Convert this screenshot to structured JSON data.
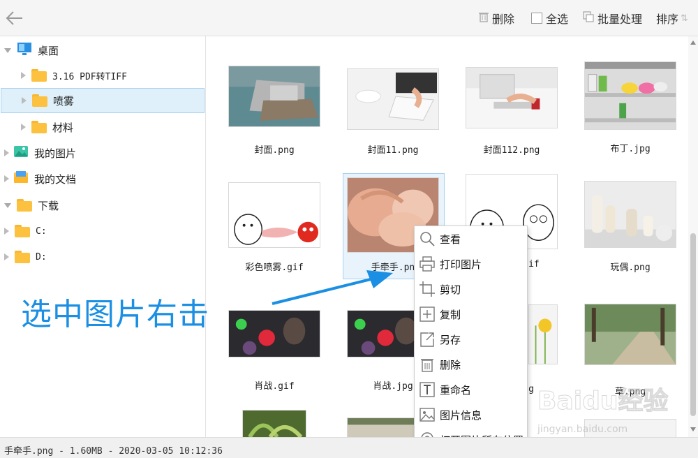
{
  "toolbar": {
    "delete_label": "删除",
    "select_all_label": "全选",
    "batch_label": "批量处理",
    "sort_label": "排序"
  },
  "sidebar": {
    "items": [
      {
        "label": "桌面",
        "icon": "desktop-icon",
        "expanded": true
      },
      {
        "label": "3.16 PDF转TIFF",
        "icon": "folder-icon",
        "expanded": false
      },
      {
        "label": "喷雾",
        "icon": "folder-icon",
        "expanded": false,
        "selected": true
      },
      {
        "label": "材料",
        "icon": "folder-icon",
        "expanded": false
      },
      {
        "label": "我的图片",
        "icon": "pictures-icon",
        "expanded": false
      },
      {
        "label": "我的文档",
        "icon": "documents-icon",
        "expanded": false
      },
      {
        "label": "下载",
        "icon": "folder-icon",
        "expanded": true
      },
      {
        "label": "C:",
        "icon": "folder-icon",
        "expanded": false
      },
      {
        "label": "D:",
        "icon": "folder-icon",
        "expanded": false
      }
    ]
  },
  "files": [
    {
      "name": "封面.png"
    },
    {
      "name": "封面11.png"
    },
    {
      "name": "封面112.png"
    },
    {
      "name": "布丁.jpg"
    },
    {
      "name": "彩色喷雾.gif"
    },
    {
      "name": "手牵手.pn",
      "selected": true
    },
    {
      "name": "gif"
    },
    {
      "name": "玩偶.png"
    },
    {
      "name": "肖战.gif"
    },
    {
      "name": "肖战.jpg"
    },
    {
      "name": "g"
    },
    {
      "name": "草.png"
    }
  ],
  "context_menu": {
    "items": [
      {
        "label": "查看",
        "icon": "magnifier-icon"
      },
      {
        "label": "打印图片",
        "icon": "printer-icon"
      },
      {
        "label": "剪切",
        "icon": "crop-icon"
      },
      {
        "label": "复制",
        "icon": "copy-icon"
      },
      {
        "label": "另存",
        "icon": "save-as-icon"
      },
      {
        "label": "删除",
        "icon": "trash-icon"
      },
      {
        "label": "重命名",
        "icon": "text-icon"
      },
      {
        "label": "图片信息",
        "icon": "image-info-icon"
      },
      {
        "label": "打开图片所在位置",
        "icon": "location-icon"
      }
    ]
  },
  "annotation": {
    "text": "选中图片右击",
    "color": "#1a8fe3"
  },
  "status": {
    "text": "手牵手.png - 1.60MB - 2020-03-05 10:12:36"
  },
  "watermark": {
    "main": "Baidu经验",
    "sub": "jingyan.baidu.com"
  },
  "colors": {
    "selection_bg": "#dff0fb",
    "selection_border": "#a8d2f0",
    "folder": "#fcc13e"
  }
}
